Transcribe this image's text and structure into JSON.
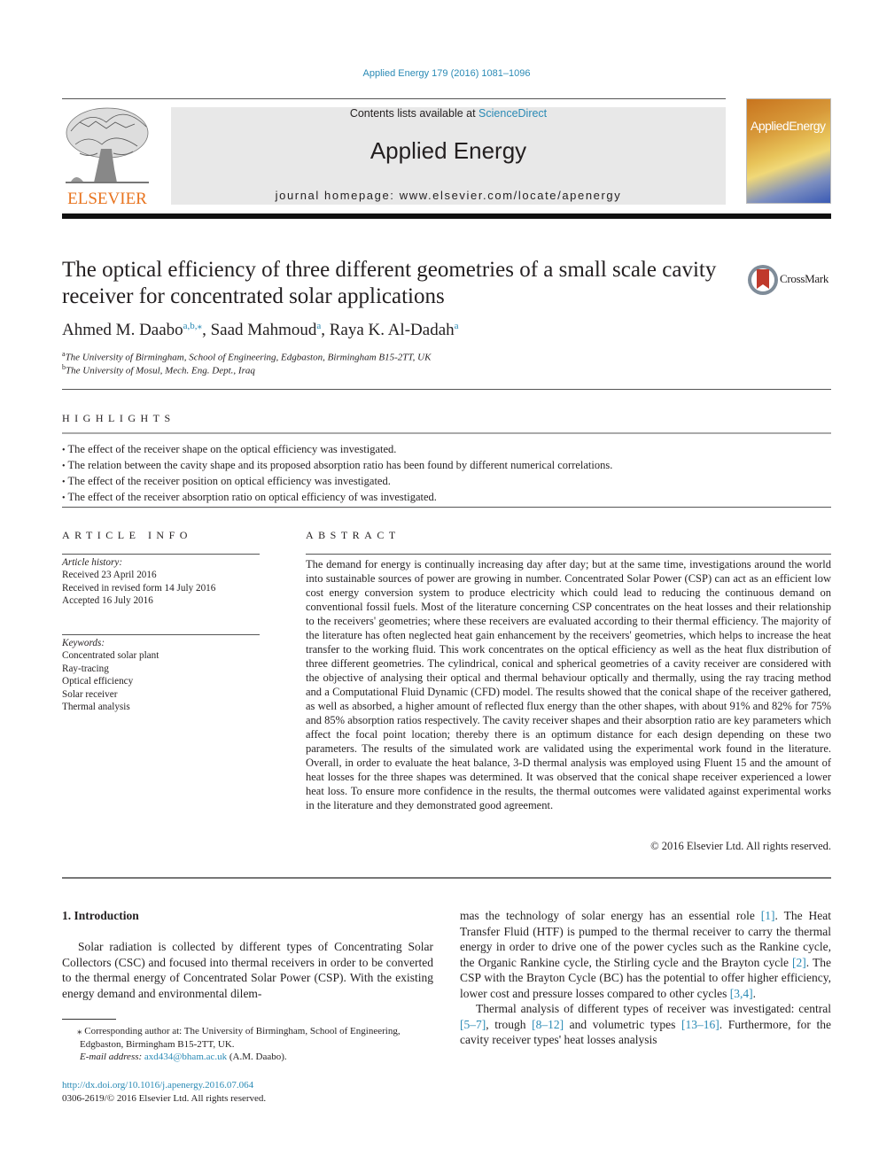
{
  "header": {
    "citation": "Applied Energy 179 (2016) 1081–1096",
    "contents_prefix": "Contents lists available at ",
    "contents_link": "ScienceDirect",
    "journal_name": "Applied Energy",
    "homepage": "journal homepage: www.elsevier.com/locate/apenergy",
    "publisher_logo_text": "ELSEVIER",
    "cover_title_a": "Applied",
    "cover_title_b": "Energy",
    "crossmark_label": "CrossMark"
  },
  "colors": {
    "link": "#2a8ab5",
    "elsevier_orange": "#e8731e",
    "crossmark_red": "#c0392b"
  },
  "article": {
    "title": "The optical efficiency of three different geometries of a small scale cavity receiver for concentrated solar applications",
    "authors": [
      {
        "name": "Ahmed M. Daabo",
        "sup": "a,b,⁎"
      },
      {
        "name": "Saad Mahmoud",
        "sup": "a"
      },
      {
        "name": "Raya K. Al-Dadah",
        "sup": "a"
      }
    ],
    "affiliations": [
      {
        "mark": "a",
        "text": "The University of Birmingham, School of Engineering, Edgbaston, Birmingham B15-2TT, UK"
      },
      {
        "mark": "b",
        "text": "The University of Mosul, Mech. Eng. Dept., Iraq"
      }
    ]
  },
  "highlights": {
    "label": "HIGHLIGHTS",
    "items": [
      "The effect of the receiver shape on the optical efficiency was investigated.",
      "The relation between the cavity shape and its proposed absorption ratio has been found by different numerical correlations.",
      "The effect of the receiver position on optical efficiency was investigated.",
      "The effect of the receiver absorption ratio on optical efficiency of was investigated."
    ]
  },
  "article_info": {
    "label": "ARTICLE INFO",
    "history_label": "Article history:",
    "history": [
      "Received 23 April 2016",
      "Received in revised form 14 July 2016",
      "Accepted 16 July 2016"
    ],
    "keywords_label": "Keywords:",
    "keywords": [
      "Concentrated solar plant",
      "Ray-tracing",
      "Optical efficiency",
      "Solar receiver",
      "Thermal analysis"
    ]
  },
  "abstract": {
    "label": "ABSTRACT",
    "text": "The demand for energy is continually increasing day after day; but at the same time, investigations around the world into sustainable sources of power are growing in number. Concentrated Solar Power (CSP) can act as an efficient low cost energy conversion system to produce electricity which could lead to reducing the continuous demand on conventional fossil fuels. Most of the literature concerning CSP concentrates on the heat losses and their relationship to the receivers' geometries; where these receivers are evaluated according to their thermal efficiency. The majority of the literature has often neglected heat gain enhancement by the receivers' geometries, which helps to increase the heat transfer to the working fluid. This work concentrates on the optical efficiency as well as the heat flux distribution of three different geometries. The cylindrical, conical and spherical geometries of a cavity receiver are considered with the objective of analysing their optical and thermal behaviour optically and thermally, using the ray tracing method and a Computational Fluid Dynamic (CFD) model. The results showed that the conical shape of the receiver gathered, as well as absorbed, a higher amount of reflected flux energy than the other shapes, with about 91% and 82% for 75% and 85% absorption ratios respectively. The cavity receiver shapes and their absorption ratio are key parameters which affect the focal point location; thereby there is an optimum distance for each design depending on these two parameters. The results of the simulated work are validated using the experimental work found in the literature. Overall, in order to evaluate the heat balance, 3-D thermal analysis was employed using Fluent 15 and the amount of heat losses for the three shapes was determined. It was observed that the conical shape receiver experienced a lower heat loss. To ensure more confidence in the results, the thermal outcomes were validated against experimental works in the literature and they demonstrated good agreement.",
    "copyright": "© 2016 Elsevier Ltd. All rights reserved."
  },
  "introduction": {
    "heading": "1. Introduction",
    "left_para": "Solar radiation is collected by different types of Concentrating Solar Collectors (CSC) and focused into thermal receivers in order to be converted to the thermal energy of Concentrated Solar Power (CSP). With the existing energy demand and environmental dilem-",
    "right_p1": [
      {
        "t": "mas the technology of solar energy has an essential role "
      },
      {
        "ref": "[1]"
      },
      {
        "t": ". The Heat Transfer Fluid (HTF) is pumped to the thermal receiver to carry the thermal energy in order to drive one of the power cycles such as the Rankine cycle, the Organic Rankine cycle, the Stirling cycle and the Brayton cycle "
      },
      {
        "ref": "[2]"
      },
      {
        "t": ". The CSP with the Brayton Cycle (BC) has the potential to offer higher efficiency, lower cost and pressure losses compared to other cycles "
      },
      {
        "ref": "[3,4]"
      },
      {
        "t": "."
      }
    ],
    "right_p2": [
      {
        "t": "Thermal analysis of different types of receiver was investigated: central "
      },
      {
        "ref": "[5–7]"
      },
      {
        "t": ", trough "
      },
      {
        "ref": "[8–12]"
      },
      {
        "t": " and volumetric types "
      },
      {
        "ref": "[13–16]"
      },
      {
        "t": ". Furthermore, for the cavity receiver types' heat losses analysis"
      }
    ]
  },
  "footnotes": {
    "corresponding_mark": "⁎",
    "corresponding": "Corresponding author at: The University of Birmingham, School of Engineering, Edgbaston, Birmingham B15-2TT, UK.",
    "email_label": "E-mail address: ",
    "email": "axd434@bham.ac.uk",
    "email_suffix": " (A.M. Daabo).",
    "doi": "http://dx.doi.org/10.1016/j.apenergy.2016.07.064",
    "issn": "0306-2619/© 2016 Elsevier Ltd. All rights reserved."
  }
}
